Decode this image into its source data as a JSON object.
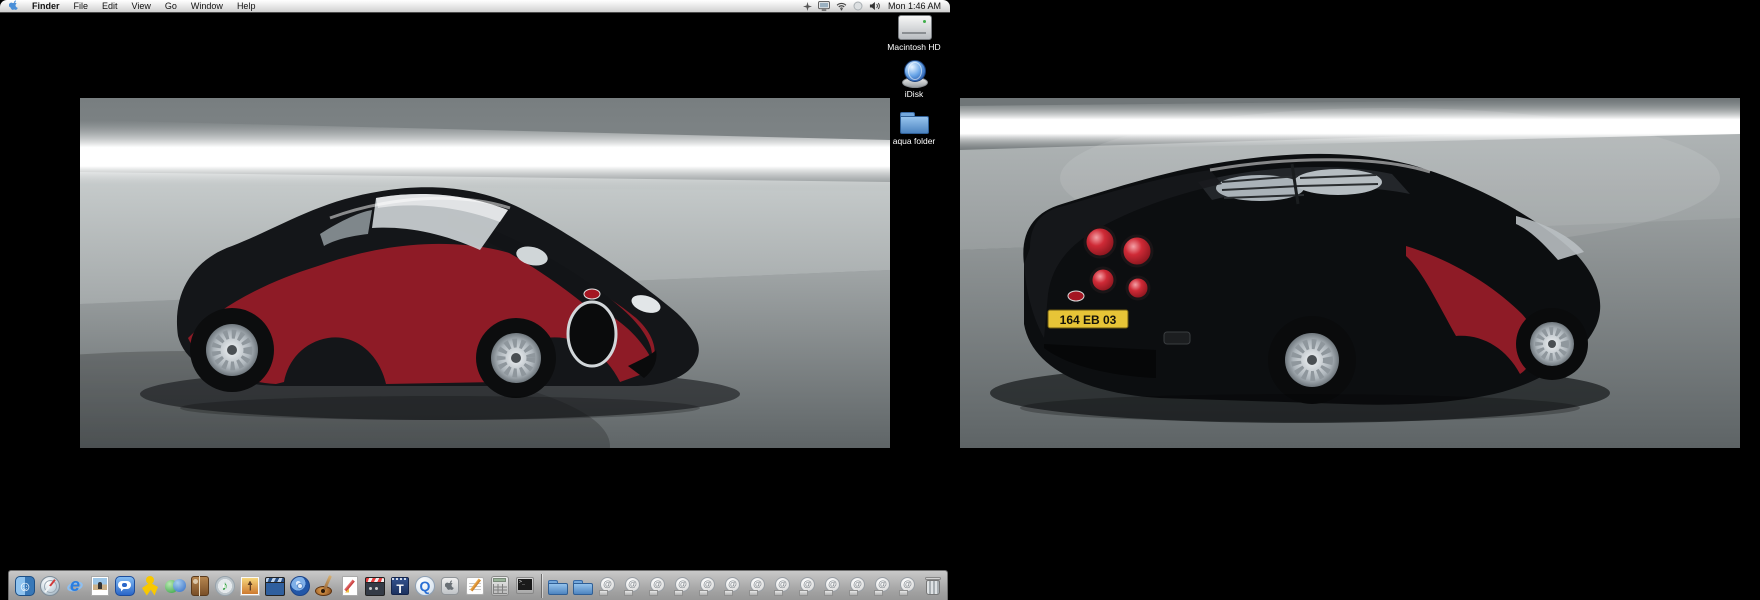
{
  "menu_bar": {
    "apple_menu": {
      "icon": "apple-logo"
    },
    "menus": [
      {
        "label": "Finder",
        "bold": true
      },
      {
        "label": "File"
      },
      {
        "label": "Edit"
      },
      {
        "label": "View"
      },
      {
        "label": "Go"
      },
      {
        "label": "Window"
      },
      {
        "label": "Help"
      }
    ],
    "status_icons": [
      {
        "name": "bluetooth"
      },
      {
        "name": "displays"
      },
      {
        "name": "airport"
      },
      {
        "name": "sync"
      },
      {
        "name": "volume"
      }
    ],
    "clock": "Mon 1:46 AM"
  },
  "desktop": {
    "background_color": "#000000",
    "icons": [
      {
        "label": "Macintosh HD",
        "kind": "hard-drive"
      },
      {
        "label": "iDisk",
        "kind": "idisk-globe"
      },
      {
        "label": "aqua folder",
        "kind": "folder"
      }
    ],
    "pictures": [
      {
        "name": "bugatti-veyron-front-view",
        "scene": {
          "wall": "#a9aeaf",
          "light_streak": "#ffffff",
          "floor": "#646a6c"
        },
        "car": {
          "body": "#141619",
          "panels": "#8e1b26",
          "badge": "#a41622"
        }
      },
      {
        "name": "bugatti-veyron-rear-view",
        "license_plate": "164 EB 03",
        "scene": {
          "wall": "#9aa0a1",
          "light_streak": "#ffffff",
          "floor": "#5e6466"
        },
        "car": {
          "body": "#0c0e10",
          "door_panel": "#8e1b26",
          "taillight": "#cf2a36",
          "plate_bg": "#e7c437"
        }
      }
    ]
  },
  "dock": {
    "apps": [
      {
        "name": "finder"
      },
      {
        "name": "safari"
      },
      {
        "name": "internet-explorer"
      },
      {
        "name": "photo-viewer"
      },
      {
        "name": "ichat"
      },
      {
        "name": "aim"
      },
      {
        "name": "msn-messenger"
      },
      {
        "name": "address-book"
      },
      {
        "name": "itunes"
      },
      {
        "name": "iphoto"
      },
      {
        "name": "imovie"
      },
      {
        "name": "dvd-player"
      },
      {
        "name": "garageband"
      },
      {
        "name": "appleworks"
      },
      {
        "name": "film-clapper"
      },
      {
        "name": "t-film-app"
      },
      {
        "name": "quicktime"
      },
      {
        "name": "apple-box-app"
      },
      {
        "name": "textedit"
      },
      {
        "name": "calculator"
      },
      {
        "name": "terminal"
      }
    ],
    "folders": [
      {
        "name": "folder-1"
      },
      {
        "name": "folder-2"
      }
    ],
    "mail_stamps": {
      "name": "mail-stamp",
      "count": 13
    },
    "trash": {
      "name": "trash"
    }
  }
}
